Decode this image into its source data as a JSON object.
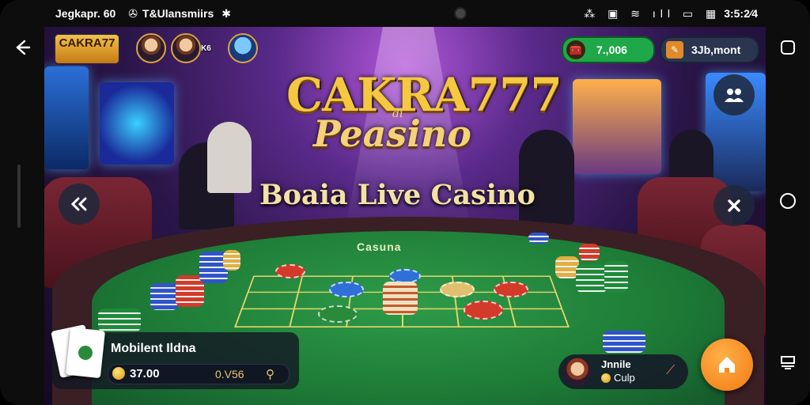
{
  "statusbar": {
    "left_text": "Jegkapr. 60",
    "app_name": "T&Ulansmiirs",
    "time": "3:5:2⁄4"
  },
  "header": {
    "brand": "CAKRA77",
    "brand_sub": "",
    "avatars": [
      {
        "label": ""
      },
      {
        "label": "K6"
      },
      {
        "label": ""
      }
    ],
    "balance": "7.,006",
    "account": "3Jb,mont"
  },
  "hero": {
    "logo_line1": "CAKRA777",
    "logo_di": "di",
    "logo_line2": "Peasino",
    "tagline": "Boaia Live Casino"
  },
  "table": {
    "felt_label": "Casuna"
  },
  "bottom_panel": {
    "title": "Mobilent Ildna",
    "coins": "37.00",
    "odds": "0.V56"
  },
  "player": {
    "name": "Jnnile",
    "status": "Culp"
  },
  "icons": {
    "back": "back-arrow-icon",
    "collapse": "double-chevron-left-icon",
    "close": "close-x-icon",
    "people": "group-icon",
    "home": "home-icon"
  },
  "colors": {
    "balance_pill": "#1fa84a",
    "fab": "#f28a1e",
    "gold": "#f5c842"
  }
}
